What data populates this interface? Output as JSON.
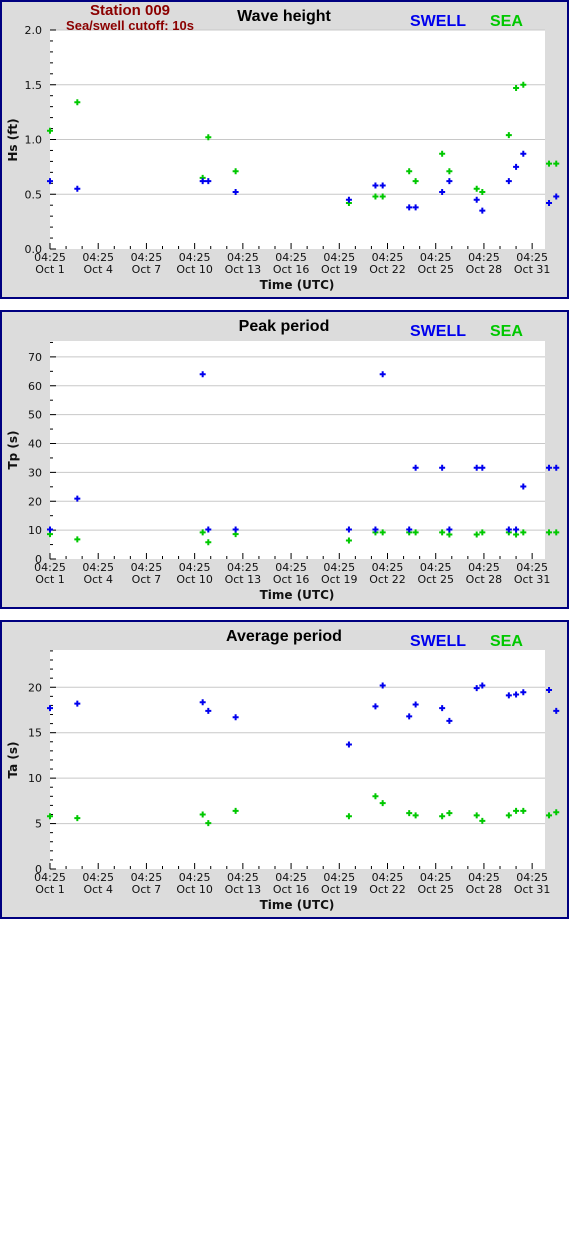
{
  "header": {
    "station": "Station 009",
    "cutoff": "Sea/swell cutoff: 10s"
  },
  "colors": {
    "swell": "#0000ee",
    "sea": "#00c800",
    "panel_bg": "#dcdcdc",
    "panel_border": "#000080",
    "grid": "#c8c8c8",
    "station_text": "#8b0000"
  },
  "legend": {
    "swell": "SWELL",
    "sea": "SEA"
  },
  "chart_data": [
    {
      "type": "scatter",
      "title": "Wave height",
      "xlabel": "Time (UTC)",
      "ylabel": "Hs (ft)",
      "ylim": [
        0,
        2.0
      ],
      "yticks": [
        "0.0",
        "0.5",
        "1.0",
        "1.5",
        "2.0"
      ],
      "ytick_values": [
        0,
        0.5,
        1.0,
        1.5,
        2.0
      ],
      "yminor_step": 0.1,
      "grid": true,
      "legend_position": "top-right",
      "x_unit": "days since Oct 1 04:25 UTC",
      "xlim": [
        0,
        30.8
      ],
      "xticks": [
        {
          "top": "04:25",
          "bottom": "Oct 1",
          "value": 0
        },
        {
          "top": "04:25",
          "bottom": "Oct 4",
          "value": 3
        },
        {
          "top": "04:25",
          "bottom": "Oct 7",
          "value": 6
        },
        {
          "top": "04:25",
          "bottom": "Oct 10",
          "value": 9
        },
        {
          "top": "04:25",
          "bottom": "Oct 13",
          "value": 12
        },
        {
          "top": "04:25",
          "bottom": "Oct 16",
          "value": 15
        },
        {
          "top": "04:25",
          "bottom": "Oct 19",
          "value": 18
        },
        {
          "top": "04:25",
          "bottom": "Oct 22",
          "value": 21
        },
        {
          "top": "04:25",
          "bottom": "Oct 25",
          "value": 24
        },
        {
          "top": "04:25",
          "bottom": "Oct 28",
          "value": 27
        },
        {
          "top": "04:25",
          "bottom": "Oct 31",
          "value": 30
        }
      ],
      "x": [
        0,
        1.7,
        9.5,
        9.85,
        11.55,
        18.6,
        20.25,
        20.7,
        22.35,
        22.75,
        24.4,
        24.85,
        26.55,
        26.9,
        28.55,
        29.0,
        29.45,
        31.05,
        31.5
      ],
      "series": [
        {
          "name": "SWELL",
          "values": [
            0.62,
            0.55,
            0.62,
            0.62,
            0.52,
            0.45,
            0.58,
            0.58,
            0.38,
            0.38,
            0.52,
            0.62,
            0.45,
            0.35,
            0.62,
            0.75,
            0.87,
            0.42,
            0.48
          ]
        },
        {
          "name": "SEA",
          "values": [
            1.08,
            1.34,
            0.65,
            1.02,
            0.71,
            0.42,
            0.48,
            0.48,
            0.71,
            0.62,
            0.87,
            0.71,
            0.55,
            0.52,
            1.04,
            1.47,
            1.5,
            0.78,
            0.78
          ]
        }
      ]
    },
    {
      "type": "scatter",
      "title": "Peak period",
      "xlabel": "Time (UTC)",
      "ylabel": "Tp (s)",
      "ylim": [
        0,
        75.5
      ],
      "yticks": [
        "0",
        "10",
        "20",
        "30",
        "40",
        "50",
        "60",
        "70"
      ],
      "ytick_values": [
        0,
        10,
        20,
        30,
        40,
        50,
        60,
        70
      ],
      "yminor_step": 5,
      "grid": true,
      "legend_position": "top-right",
      "x_unit": "days since Oct 1 04:25 UTC",
      "xlim": [
        0,
        30.8
      ],
      "xticks": [
        {
          "top": "04:25",
          "bottom": "Oct 1",
          "value": 0
        },
        {
          "top": "04:25",
          "bottom": "Oct 4",
          "value": 3
        },
        {
          "top": "04:25",
          "bottom": "Oct 7",
          "value": 6
        },
        {
          "top": "04:25",
          "bottom": "Oct 10",
          "value": 9
        },
        {
          "top": "04:25",
          "bottom": "Oct 13",
          "value": 12
        },
        {
          "top": "04:25",
          "bottom": "Oct 16",
          "value": 15
        },
        {
          "top": "04:25",
          "bottom": "Oct 19",
          "value": 18
        },
        {
          "top": "04:25",
          "bottom": "Oct 22",
          "value": 21
        },
        {
          "top": "04:25",
          "bottom": "Oct 25",
          "value": 24
        },
        {
          "top": "04:25",
          "bottom": "Oct 28",
          "value": 27
        },
        {
          "top": "04:25",
          "bottom": "Oct 31",
          "value": 30
        }
      ],
      "x": [
        0,
        1.7,
        9.5,
        9.85,
        11.55,
        18.6,
        20.25,
        20.7,
        22.35,
        22.75,
        24.4,
        24.85,
        26.55,
        26.9,
        28.55,
        29.0,
        29.45,
        31.05,
        31.5
      ],
      "series": [
        {
          "name": "SWELL",
          "values": [
            10.2,
            20.9,
            64,
            10.2,
            10.2,
            10.2,
            10.2,
            64,
            10.2,
            31.6,
            31.6,
            10.2,
            31.6,
            31.6,
            10.2,
            10.2,
            25.1,
            31.6,
            31.6
          ]
        },
        {
          "name": "SEA",
          "values": [
            8.6,
            6.8,
            9.2,
            5.8,
            8.6,
            6.4,
            9.2,
            9.2,
            9.2,
            9.2,
            9.2,
            8.5,
            8.5,
            9.2,
            9.2,
            8.5,
            9.2,
            9.2,
            9.2
          ]
        }
      ]
    },
    {
      "type": "scatter",
      "title": "Average period",
      "xlabel": "Time (UTC)",
      "ylabel": "Ta (s)",
      "ylim": [
        0,
        24.1
      ],
      "yticks": [
        "0",
        "5",
        "10",
        "15",
        "20"
      ],
      "ytick_values": [
        0,
        5,
        10,
        15,
        20
      ],
      "yminor_step": 1,
      "grid": true,
      "legend_position": "top-right",
      "x_unit": "days since Oct 1 04:25 UTC",
      "xlim": [
        0,
        30.8
      ],
      "xticks": [
        {
          "top": "04:25",
          "bottom": "Oct 1",
          "value": 0
        },
        {
          "top": "04:25",
          "bottom": "Oct 4",
          "value": 3
        },
        {
          "top": "04:25",
          "bottom": "Oct 7",
          "value": 6
        },
        {
          "top": "04:25",
          "bottom": "Oct 10",
          "value": 9
        },
        {
          "top": "04:25",
          "bottom": "Oct 13",
          "value": 12
        },
        {
          "top": "04:25",
          "bottom": "Oct 16",
          "value": 15
        },
        {
          "top": "04:25",
          "bottom": "Oct 19",
          "value": 18
        },
        {
          "top": "04:25",
          "bottom": "Oct 22",
          "value": 21
        },
        {
          "top": "04:25",
          "bottom": "Oct 25",
          "value": 24
        },
        {
          "top": "04:25",
          "bottom": "Oct 28",
          "value": 27
        },
        {
          "top": "04:25",
          "bottom": "Oct 31",
          "value": 30
        }
      ],
      "x": [
        0,
        1.7,
        9.5,
        9.85,
        11.55,
        18.6,
        20.25,
        20.7,
        22.35,
        22.75,
        24.4,
        24.85,
        26.55,
        26.9,
        28.55,
        29.0,
        29.45,
        31.05,
        31.5
      ],
      "series": [
        {
          "name": "SWELL",
          "values": [
            17.7,
            18.2,
            18.35,
            17.4,
            16.7,
            13.7,
            17.9,
            20.2,
            16.8,
            18.1,
            17.7,
            16.3,
            19.9,
            20.2,
            19.1,
            19.2,
            19.45,
            19.7,
            17.4
          ]
        },
        {
          "name": "SEA",
          "values": [
            5.8,
            5.6,
            6.0,
            5.05,
            6.4,
            5.8,
            8.0,
            7.25,
            6.15,
            5.9,
            5.8,
            6.15,
            5.9,
            5.3,
            5.9,
            6.4,
            6.4,
            5.9,
            6.25
          ]
        }
      ]
    }
  ]
}
